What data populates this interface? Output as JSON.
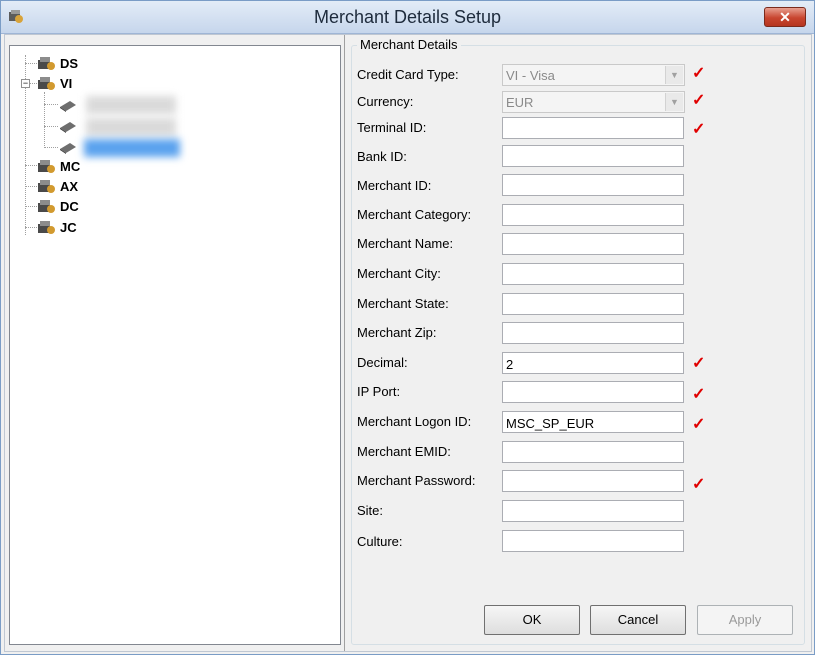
{
  "window": {
    "title": "Merchant Details Setup",
    "close_label": "✕"
  },
  "tree": {
    "nodes": [
      {
        "label": "DS"
      },
      {
        "label": "VI",
        "expander": "−"
      },
      {
        "label": "MC"
      },
      {
        "label": "AX"
      },
      {
        "label": "DC"
      },
      {
        "label": "JC"
      }
    ]
  },
  "group": {
    "title": "Merchant Details"
  },
  "fields": {
    "credit_card_type": {
      "label": "Credit Card Type:",
      "value": "VI - Visa"
    },
    "currency": {
      "label": "Currency:",
      "value": "EUR"
    },
    "terminal_id": {
      "label": "Terminal ID:",
      "value": ""
    },
    "bank_id": {
      "label": "Bank ID:",
      "value": ""
    },
    "merchant_id": {
      "label": "Merchant ID:",
      "value": ""
    },
    "merchant_category": {
      "label": "Merchant Category:",
      "value": ""
    },
    "merchant_name": {
      "label": "Merchant Name:",
      "value": ""
    },
    "merchant_city": {
      "label": "Merchant City:",
      "value": ""
    },
    "merchant_state": {
      "label": "Merchant State:",
      "value": ""
    },
    "merchant_zip": {
      "label": "Merchant Zip:",
      "value": ""
    },
    "decimal": {
      "label": "Decimal:",
      "value": "2"
    },
    "ip_port": {
      "label": "IP Port:",
      "value": ""
    },
    "merchant_logon_id": {
      "label": "Merchant Logon ID:",
      "value": "MSC_SP_EUR"
    },
    "merchant_emid": {
      "label": "Merchant EMID:",
      "value": ""
    },
    "merchant_password": {
      "label": "Merchant Password:",
      "value": ""
    },
    "site": {
      "label": "Site:",
      "value": ""
    },
    "culture": {
      "label": "Culture:",
      "value": ""
    }
  },
  "required_mark": "✓",
  "buttons": {
    "ok": "OK",
    "cancel": "Cancel",
    "apply": "Apply"
  },
  "colors": {
    "required": "#e00000",
    "title_bar": "#c6d6ec",
    "close": "#c8452f"
  }
}
